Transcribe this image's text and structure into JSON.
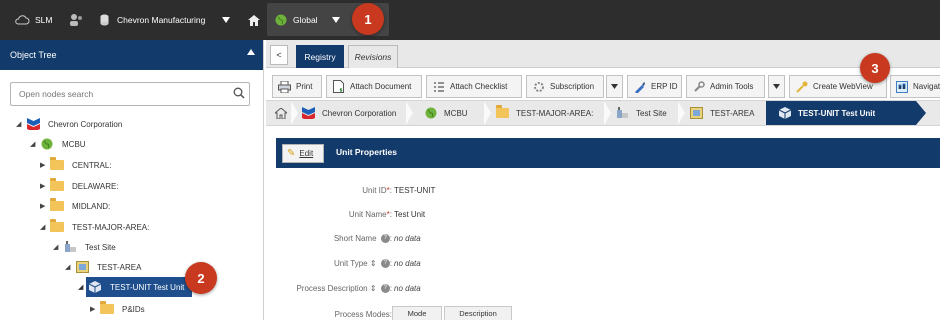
{
  "topbar": {
    "app": "SLM",
    "company": "Chevron Manufacturing",
    "scope": "Global"
  },
  "callouts": [
    "1",
    "2",
    "3"
  ],
  "tree": {
    "header": "Object Tree",
    "search_placeholder": "Open nodes search",
    "nodes": [
      {
        "label": "Chevron Corporation",
        "expand": "expanded",
        "icon": "chevron-logo-icon"
      },
      {
        "label": "MCBU",
        "expand": "expanded",
        "icon": "globe-icon"
      },
      {
        "label": "CENTRAL:",
        "expand": "collapsed",
        "icon": "folder-icon"
      },
      {
        "label": "DELAWARE:",
        "expand": "collapsed",
        "icon": "folder-icon"
      },
      {
        "label": "MIDLAND:",
        "expand": "collapsed",
        "icon": "folder-icon"
      },
      {
        "label": "TEST-MAJOR-AREA:",
        "expand": "expanded",
        "icon": "folder-icon"
      },
      {
        "label": "Test Site",
        "expand": "expanded",
        "icon": "site-icon"
      },
      {
        "label": "TEST-AREA",
        "expand": "expanded",
        "icon": "area-icon"
      },
      {
        "label": "TEST-UNIT Test Unit",
        "expand": "expanded",
        "icon": "unit-icon"
      },
      {
        "label": "P&IDs",
        "expand": "collapsed",
        "icon": "folder-icon"
      }
    ]
  },
  "main": {
    "tabs": [
      {
        "label": "Registry",
        "active": true
      },
      {
        "label": "Revisions",
        "active": false
      }
    ],
    "toolbar": [
      {
        "label": "Print",
        "icon": "printer-icon"
      },
      {
        "label": "Attach Document",
        "icon": "attach-document-icon"
      },
      {
        "label": "Attach Checklist",
        "icon": "checklist-icon"
      },
      {
        "label": "Subscription",
        "icon": "subscription-icon"
      },
      {
        "label": "ERP ID",
        "icon": "erp-icon"
      },
      {
        "label": "Admin Tools",
        "icon": "wrench-icon"
      },
      {
        "label": "Create WebView",
        "icon": "key-icon"
      },
      {
        "label": "Navigat",
        "icon": "navigate-icon"
      }
    ],
    "breadcrumbs": [
      {
        "label": "Chevron Corporation",
        "icon": "chevron-logo-icon"
      },
      {
        "label": "MCBU",
        "icon": "globe-icon"
      },
      {
        "label": "TEST-MAJOR-AREA:",
        "icon": "folder-icon"
      },
      {
        "label": "Test Site",
        "icon": "site-icon"
      },
      {
        "label": "TEST-AREA",
        "icon": "area-icon"
      },
      {
        "label": "TEST-UNIT Test Unit",
        "icon": "unit-icon"
      }
    ],
    "panel": {
      "edit_label": "Edit",
      "title": "Unit Properties"
    },
    "properties": [
      {
        "label": "Unit ID",
        "required": "*",
        "value": "TEST-UNIT",
        "help": false
      },
      {
        "label": "Unit Name",
        "required": "*",
        "value": "Test Unit",
        "help": false
      },
      {
        "label": "Short Name",
        "required": "",
        "value": "no data",
        "help": true
      },
      {
        "label": "Unit Type",
        "required": "",
        "value": "no data",
        "help": true
      },
      {
        "label": "Process Description",
        "required": "",
        "value": "no data",
        "help": true
      },
      {
        "label": "Process Modes:",
        "required": "",
        "value": "",
        "help": false
      }
    ],
    "modes_table": {
      "col1": "Mode",
      "col2": "Description"
    }
  },
  "colors": {
    "topbar": "#2d2d2d",
    "navy": "#123a6b",
    "callout": "#c8391f",
    "selected": "#1e4f8c"
  }
}
